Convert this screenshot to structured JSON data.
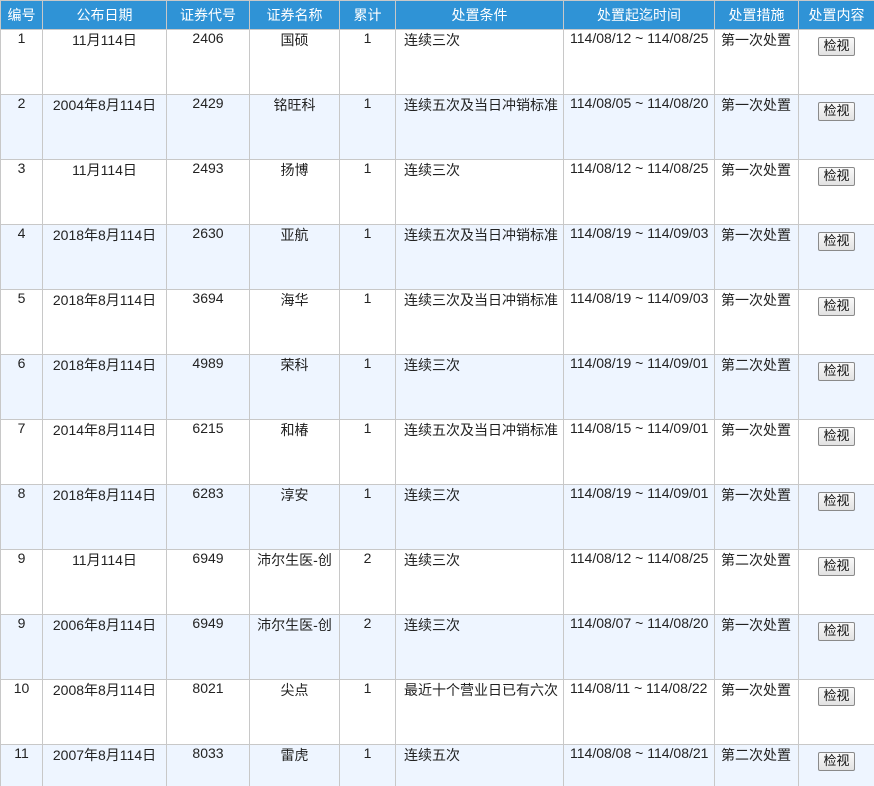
{
  "headers": [
    "编号",
    "公布日期",
    "证券代号",
    "证券名称",
    "累计",
    "处置条件",
    "处置起迄时间",
    "处置措施",
    "处置内容"
  ],
  "rows": [
    {
      "no": "1",
      "date": "11月114日",
      "code": "2406",
      "name": "国硕",
      "count": "1",
      "condition": "连续三次",
      "period": "114/08/12 ~ 114/08/25",
      "measure": "第一次处置",
      "action": "检视"
    },
    {
      "no": "2",
      "date": "2004年8月114日",
      "code": "2429",
      "name": "铭旺科",
      "count": "1",
      "condition": "连续五次及当日冲销标准",
      "period": "114/08/05 ~ 114/08/20",
      "measure": "第一次处置",
      "action": "检视"
    },
    {
      "no": "3",
      "date": "11月114日",
      "code": "2493",
      "name": "扬博",
      "count": "1",
      "condition": "连续三次",
      "period": "114/08/12 ~ 114/08/25",
      "measure": "第一次处置",
      "action": "检视"
    },
    {
      "no": "4",
      "date": "2018年8月114日",
      "code": "2630",
      "name": "亚航",
      "count": "1",
      "condition": "连续五次及当日冲销标准",
      "period": "114/08/19 ~ 114/09/03",
      "measure": "第一次处置",
      "action": "检视"
    },
    {
      "no": "5",
      "date": "2018年8月114日",
      "code": "3694",
      "name": "海华",
      "count": "1",
      "condition": "连续三次及当日冲销标准",
      "period": "114/08/19 ~ 114/09/03",
      "measure": "第一次处置",
      "action": "检视"
    },
    {
      "no": "6",
      "date": "2018年8月114日",
      "code": "4989",
      "name": "荣科",
      "count": "1",
      "condition": "连续三次",
      "period": "114/08/19 ~ 114/09/01",
      "measure": "第二次处置",
      "action": "检视"
    },
    {
      "no": "7",
      "date": "2014年8月114日",
      "code": "6215",
      "name": "和椿",
      "count": "1",
      "condition": "连续五次及当日冲销标准",
      "period": "114/08/15 ~ 114/09/01",
      "measure": "第一次处置",
      "action": "检视"
    },
    {
      "no": "8",
      "date": "2018年8月114日",
      "code": "6283",
      "name": "淳安",
      "count": "1",
      "condition": "连续三次",
      "period": "114/08/19 ~ 114/09/01",
      "measure": "第一次处置",
      "action": "检视"
    },
    {
      "no": "9",
      "date": "11月114日",
      "code": "6949",
      "name": "沛尔生医-创",
      "count": "2",
      "condition": "连续三次",
      "period": "114/08/12 ~ 114/08/25",
      "measure": "第二次处置",
      "action": "检视"
    },
    {
      "no": "9",
      "date": "2006年8月114日",
      "code": "6949",
      "name": "沛尔生医-创",
      "count": "2",
      "condition": "连续三次",
      "period": "114/08/07 ~ 114/08/20",
      "measure": "第一次处置",
      "action": "检视"
    },
    {
      "no": "10",
      "date": "2008年8月114日",
      "code": "8021",
      "name": "尖点",
      "count": "1",
      "condition": "最近十个营业日已有六次",
      "period": "114/08/11 ~ 114/08/22",
      "measure": "第一次处置",
      "action": "检视"
    },
    {
      "no": "11",
      "date": "2007年8月114日",
      "code": "8033",
      "name": "雷虎",
      "count": "1",
      "condition": "连续五次",
      "period": "114/08/08 ~ 114/08/21",
      "measure": "第二次处置",
      "action": "检视"
    }
  ],
  "colors": {
    "header_bg": "#2f93d6",
    "header_text": "#ffffff",
    "row_alt_bg": "#eef5ff",
    "row_bg": "#ffffff"
  }
}
